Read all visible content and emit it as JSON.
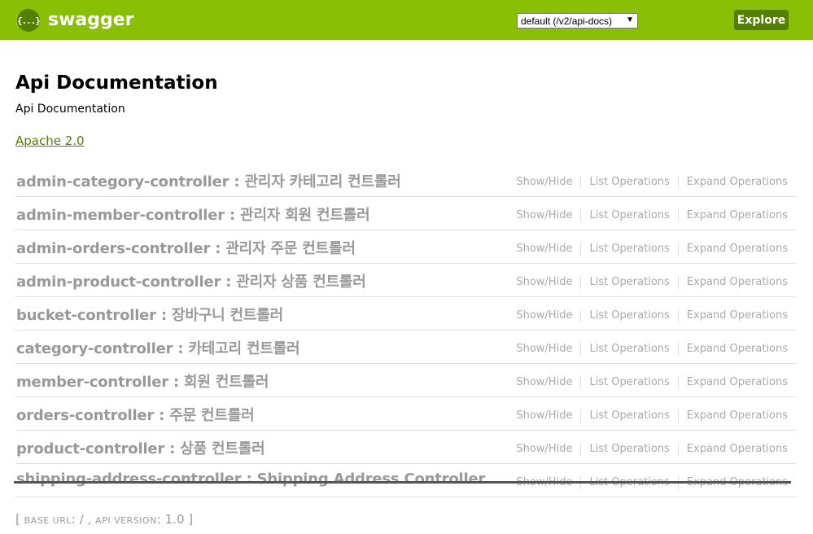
{
  "header": {
    "logo_glyph": "{...}",
    "logo_text": "swagger",
    "api_select_value": "default (/v2/api-docs)",
    "explore_label": "Explore",
    "brand_color": "#89bf04",
    "accent_color": "#547f00"
  },
  "info": {
    "title": "Api Documentation",
    "description": "Api Documentation",
    "license": "Apache 2.0"
  },
  "operations_labels": {
    "show_hide": "Show/Hide",
    "list": "List Operations",
    "expand": "Expand Operations"
  },
  "resources": [
    {
      "name": "admin-category-controller",
      "desc": "관리자 카테고리 컨트롤러"
    },
    {
      "name": "admin-member-controller",
      "desc": "관리자 회원 컨트롤러"
    },
    {
      "name": "admin-orders-controller",
      "desc": "관리자 주문 컨트롤러"
    },
    {
      "name": "admin-product-controller",
      "desc": "관리자 상품 컨트롤러"
    },
    {
      "name": "bucket-controller",
      "desc": "장바구니 컨트롤러"
    },
    {
      "name": "category-controller",
      "desc": "카테고리 컨트롤러"
    },
    {
      "name": "member-controller",
      "desc": "회원 컨트롤러"
    },
    {
      "name": "orders-controller",
      "desc": "주문 컨트롤러"
    },
    {
      "name": "product-controller",
      "desc": "상품 컨트롤러"
    },
    {
      "name": "shipping-address-controller",
      "desc": "Shipping Address Controller"
    }
  ],
  "footer": {
    "open": "[",
    "base_url_label": "BASE URL",
    "base_url_value": ": / ,",
    "api_version_label": "API VERSION",
    "api_version_value": ": 1.0",
    "close": "]"
  }
}
